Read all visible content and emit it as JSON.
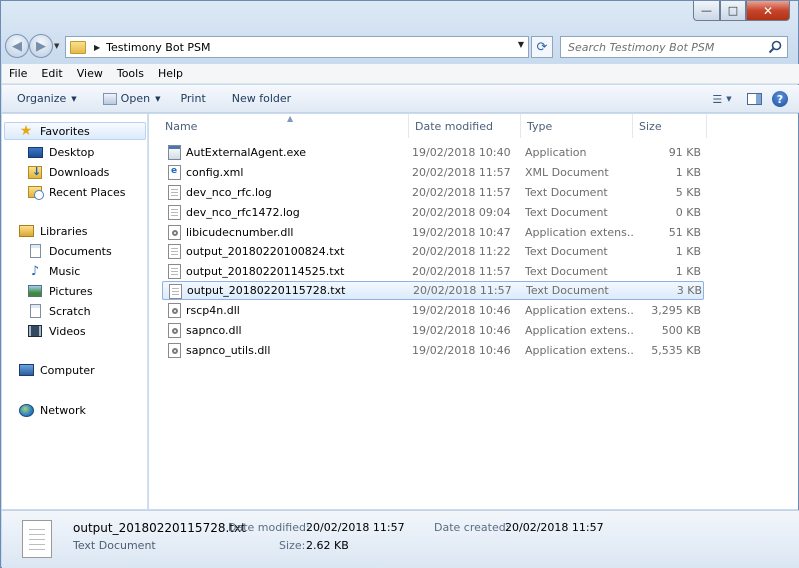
{
  "window": {
    "caption_buttons": {
      "minimize": "—",
      "maximize": "□",
      "close": "✕"
    }
  },
  "address": {
    "path": "Testimony Bot PSM",
    "search_placeholder": "Search Testimony Bot PSM"
  },
  "menu": [
    "File",
    "Edit",
    "View",
    "Tools",
    "Help"
  ],
  "toolbar": {
    "organize": "Organize",
    "open": "Open",
    "print": "Print",
    "new_folder": "New folder"
  },
  "sidebar": {
    "favorites": {
      "label": "Favorites",
      "items": [
        "Desktop",
        "Downloads",
        "Recent Places"
      ]
    },
    "libraries": {
      "label": "Libraries",
      "items": [
        "Documents",
        "Music",
        "Pictures",
        "Scratch",
        "Videos"
      ]
    },
    "computer": "Computer",
    "network": "Network"
  },
  "columns": {
    "name": "Name",
    "date": "Date modified",
    "type": "Type",
    "size": "Size"
  },
  "files": [
    {
      "name": "AutExternalAgent.exe",
      "date": "19/02/2018 10:40",
      "type": "Application",
      "size": "91 KB",
      "icon": "exe-file-icon"
    },
    {
      "name": "config.xml",
      "date": "20/02/2018 11:57",
      "type": "XML Document",
      "size": "1 KB",
      "icon": "xml-file-icon"
    },
    {
      "name": "dev_nco_rfc.log",
      "date": "20/02/2018 11:57",
      "type": "Text Document",
      "size": "5 KB",
      "icon": "text-file-icon"
    },
    {
      "name": "dev_nco_rfc1472.log",
      "date": "20/02/2018 09:04",
      "type": "Text Document",
      "size": "0 KB",
      "icon": "text-file-icon"
    },
    {
      "name": "libicudecnumber.dll",
      "date": "19/02/2018 10:47",
      "type": "Application extens...",
      "size": "51 KB",
      "icon": "dll-file-icon"
    },
    {
      "name": "output_20180220100824.txt",
      "date": "20/02/2018 11:22",
      "type": "Text Document",
      "size": "1 KB",
      "icon": "text-file-icon"
    },
    {
      "name": "output_20180220114525.txt",
      "date": "20/02/2018 11:57",
      "type": "Text Document",
      "size": "1 KB",
      "icon": "text-file-icon"
    },
    {
      "name": "output_20180220115728.txt",
      "date": "20/02/2018 11:57",
      "type": "Text Document",
      "size": "3 KB",
      "icon": "text-file-icon",
      "selected": true
    },
    {
      "name": "rscp4n.dll",
      "date": "19/02/2018 10:46",
      "type": "Application extens...",
      "size": "3,295 KB",
      "icon": "dll-file-icon"
    },
    {
      "name": "sapnco.dll",
      "date": "19/02/2018 10:46",
      "type": "Application extens...",
      "size": "500 KB",
      "icon": "dll-file-icon"
    },
    {
      "name": "sapnco_utils.dll",
      "date": "19/02/2018 10:46",
      "type": "Application extens...",
      "size": "5,535 KB",
      "icon": "dll-file-icon"
    }
  ],
  "details": {
    "filename": "output_20180220115728.txt",
    "filetype": "Text Document",
    "modified_label": "Date modified:",
    "modified_value": "20/02/2018 11:57",
    "created_label": "Date created:",
    "created_value": "20/02/2018 11:57",
    "size_label": "Size:",
    "size_value": "2.62 KB"
  }
}
